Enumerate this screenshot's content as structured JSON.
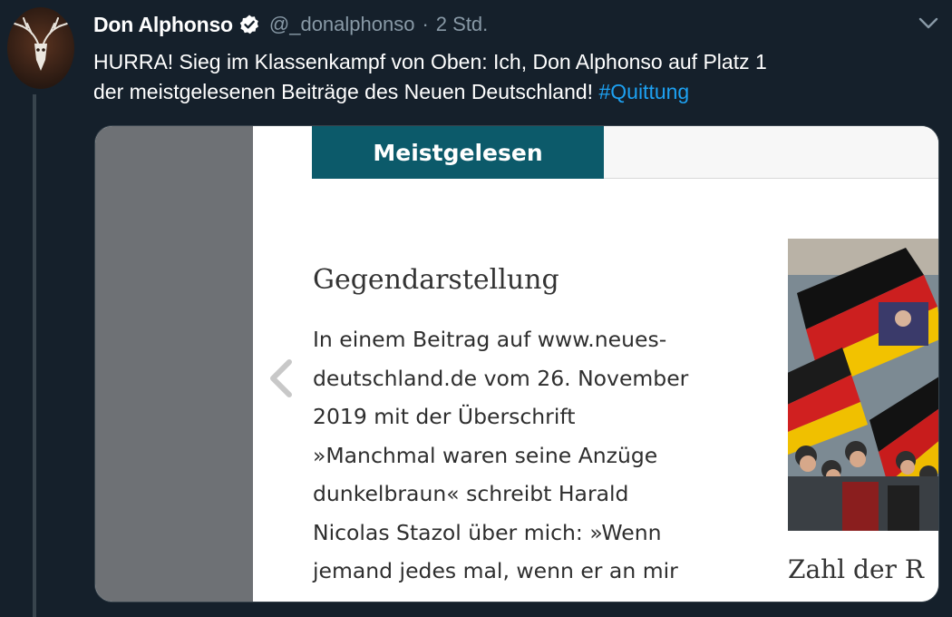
{
  "tweet": {
    "display_name": "Don Alphonso",
    "handle": "@_donalphonso",
    "separator": "·",
    "time": "2 Std.",
    "text_line1": "HURRA! Sieg im Klassenkampf von Oben: Ich, Don Alphonso auf Platz 1",
    "text_line2": "der meistgelesenen Beiträge des Neuen Deutschland!",
    "hashtag": "#Quittung"
  },
  "embed": {
    "tab_label": "Meistgelesen",
    "article_title": "Gegendarstellung",
    "article_lines": [
      "In einem Beitrag auf www.neues-",
      "deutschland.de vom 26. November",
      "2019 mit der Überschrift",
      "»Manchmal waren seine Anzüge",
      "dunkelbraun« schreibt Harald",
      "Nicolas Stazol über mich: »Wenn",
      "jemand jedes mal, wenn er an mir"
    ],
    "photo_caption": "Zahl der R"
  },
  "icons": {
    "avatar": "deer-skull-avatar",
    "verified": "verified-badge-icon",
    "menu": "chevron-down-icon",
    "carousel_prev": "chevron-left-icon"
  },
  "colors": {
    "background": "#15202b",
    "handle_gray": "#8899a6",
    "link_blue": "#1da1f2",
    "tab_teal": "#0c5a6a"
  }
}
